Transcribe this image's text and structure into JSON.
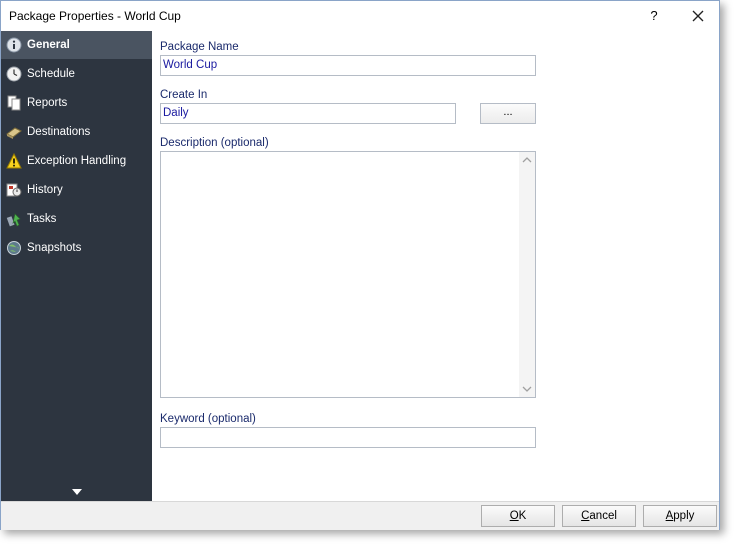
{
  "window": {
    "title": "Package Properties - World Cup",
    "help_label": "?"
  },
  "sidebar": {
    "items": [
      {
        "label": "General",
        "icon": "info-icon",
        "active": true
      },
      {
        "label": "Schedule",
        "icon": "clock-icon"
      },
      {
        "label": "Reports",
        "icon": "reports-icon"
      },
      {
        "label": "Destinations",
        "icon": "destinations-icon"
      },
      {
        "label": "Exception Handling",
        "icon": "warning-icon"
      },
      {
        "label": "History",
        "icon": "history-icon"
      },
      {
        "label": "Tasks",
        "icon": "tasks-icon"
      },
      {
        "label": "Snapshots",
        "icon": "snapshots-icon"
      }
    ]
  },
  "form": {
    "package_name_label": "Package Name",
    "package_name_value": "World Cup",
    "create_in_label": "Create In",
    "create_in_value": "Daily",
    "browse_label": "...",
    "description_label": "Description (optional)",
    "description_value": "",
    "keyword_label": "Keyword (optional)",
    "keyword_value": ""
  },
  "footer": {
    "ok_hotkey": "O",
    "ok_rest": "K",
    "cancel_hotkey": "C",
    "cancel_rest": "ancel",
    "apply_hotkey": "A",
    "apply_rest": "pply"
  }
}
